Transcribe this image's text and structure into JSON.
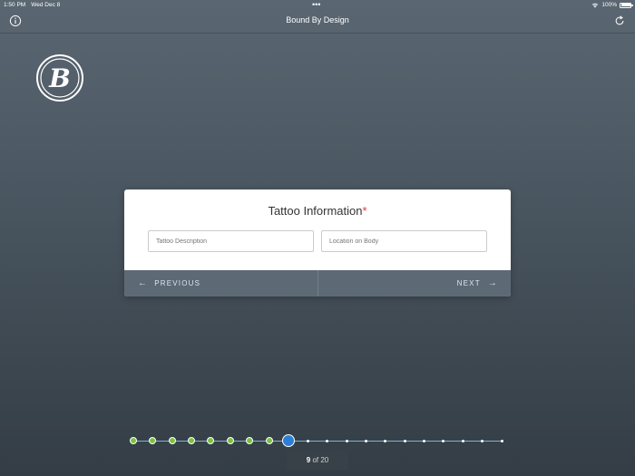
{
  "status_bar": {
    "time": "1:50 PM",
    "date": "Wed Dec 8",
    "dots": "•••",
    "battery": "100%"
  },
  "nav": {
    "title": "Bound By Design",
    "icons": [
      "info-icon",
      "refresh-icon"
    ]
  },
  "logo": {
    "glyph": "B"
  },
  "card": {
    "title": "Tattoo Information",
    "required_mark": "*",
    "fields": [
      {
        "placeholder": "Tattoo Description",
        "value": ""
      },
      {
        "placeholder": "Location on Body",
        "value": ""
      }
    ],
    "previous_label": "PREVIOUS",
    "next_label": "NEXT"
  },
  "progress": {
    "current": 9,
    "total": 20,
    "current_label": "9",
    "of_label": "of 20"
  },
  "colors": {
    "accent_blue": "#2b7fd8",
    "done_green": "#7cc242",
    "required_red": "#e53935"
  }
}
